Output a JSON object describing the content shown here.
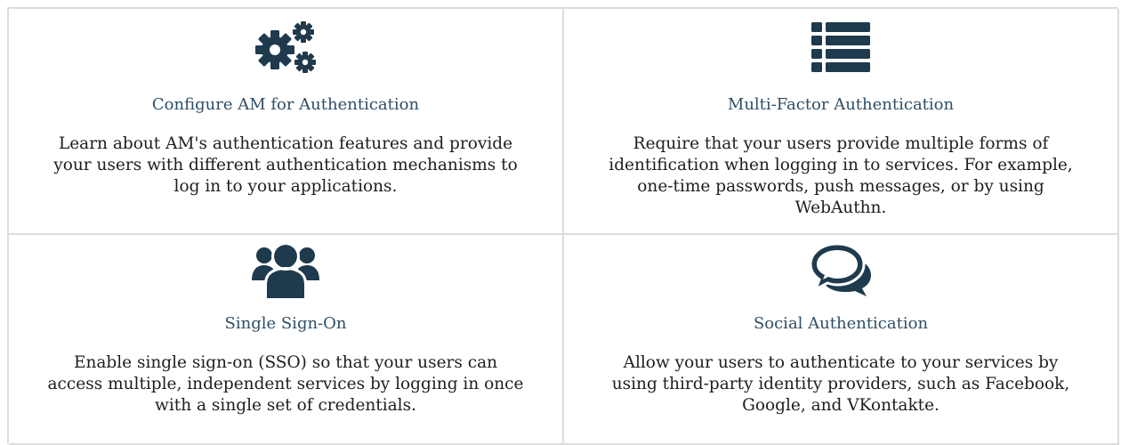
{
  "colors": {
    "icon": "#1f3a4d",
    "title": "#2f4e66",
    "text": "#1e1e1e",
    "border": "#dcdcdc"
  },
  "tiles": [
    {
      "icon": "gears-icon",
      "title": "Configure AM for Authentication",
      "description": "Learn about AM's authentication features and provide your users with different authentication mechanisms to log in to your applications."
    },
    {
      "icon": "list-icon",
      "title": "Multi-Factor Authentication",
      "description": "Require that your users provide multiple forms of identification when logging in to services. For example, one-time passwords, push messages, or by using WebAuthn."
    },
    {
      "icon": "users-icon",
      "title": "Single Sign-On",
      "description": "Enable single sign-on (SSO) so that your users can access multiple, independent services by logging in once with a single set of credentials."
    },
    {
      "icon": "chat-bubbles-icon",
      "title": "Social Authentication",
      "description": "Allow your users to authenticate to your services by using third-party identity providers, such as Facebook, Google, and VKontakte."
    }
  ]
}
